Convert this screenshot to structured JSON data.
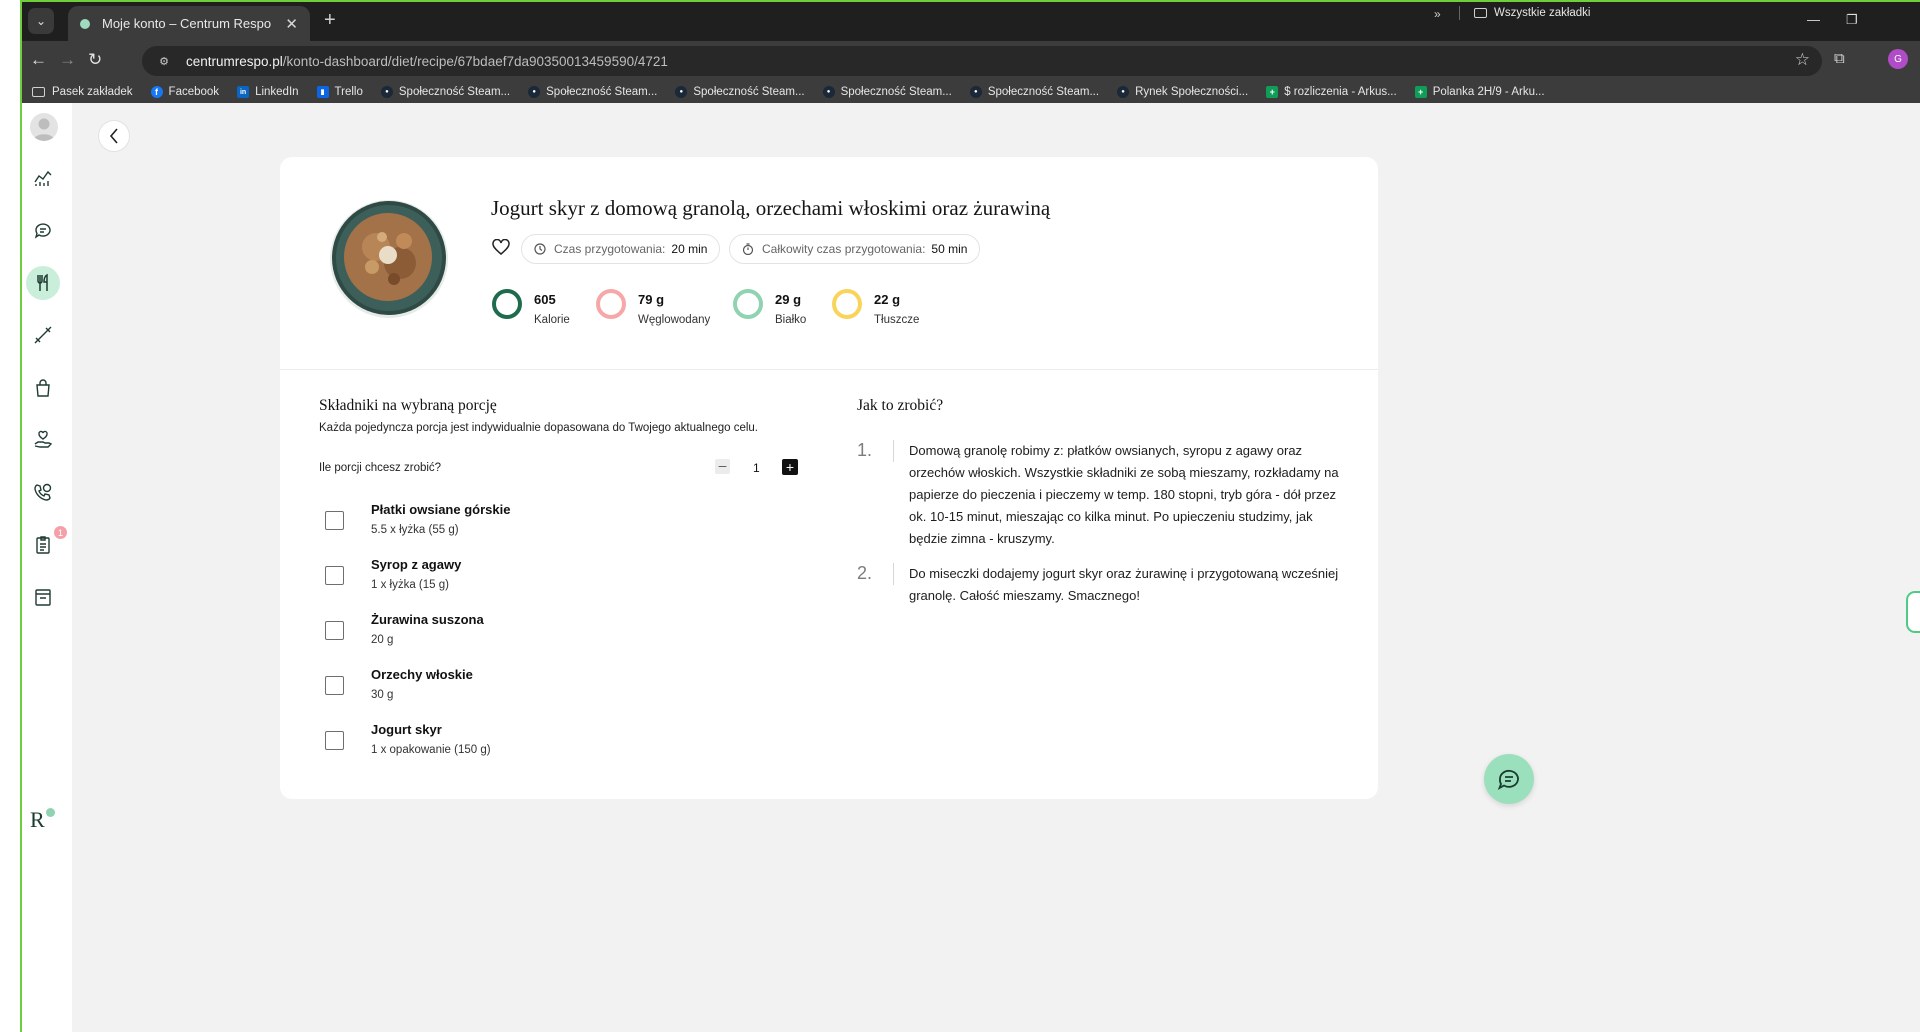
{
  "browser": {
    "tab_title": "Moje konto – Centrum Respo",
    "url_host": "centrumrespo.pl",
    "url_path": "/konto-dashboard/diet/recipe/67bdaef7da90350013459590/4721",
    "profile_initial": "G",
    "bookmarks": [
      {
        "label": "Pasek zakładek",
        "icon": "folder-icon"
      },
      {
        "label": "Facebook",
        "icon": "facebook-icon",
        "color": "#1877f2"
      },
      {
        "label": "LinkedIn",
        "icon": "linkedin-icon",
        "color": "#0a66c2"
      },
      {
        "label": "Trello",
        "icon": "trello-icon",
        "color": "#0c66e4"
      },
      {
        "label": "Społeczność Steam...",
        "icon": "steam-icon"
      },
      {
        "label": "Społeczność Steam...",
        "icon": "steam-icon"
      },
      {
        "label": "Społeczność Steam...",
        "icon": "steam-icon"
      },
      {
        "label": "Społeczność Steam...",
        "icon": "steam-icon"
      },
      {
        "label": "Społeczność Steam...",
        "icon": "steam-icon"
      },
      {
        "label": "Rynek Społeczności...",
        "icon": "steam-icon"
      },
      {
        "label": "$ rozliczenia - Arkus...",
        "icon": "sheets-icon",
        "color": "#0f9d58"
      },
      {
        "label": "Polanka 2H/9 - Arku...",
        "icon": "sheets-icon",
        "color": "#0f9d58"
      }
    ],
    "all_bookmarks_label": "Wszystkie zakładki"
  },
  "sidebar": {
    "notification_count": "1",
    "logo_text": "R"
  },
  "recipe": {
    "title": "Jogurt skyr z domową granolą, orzechami włoskimi oraz żurawiną",
    "prep_time_label": "Czas przygotowania:",
    "prep_time_value": "20 min",
    "total_time_label": "Całkowity czas przygotowania:",
    "total_time_value": "50 min",
    "macros": [
      {
        "value": "605",
        "label": "Kalorie",
        "color": "#1e6b4d"
      },
      {
        "value": "79 g",
        "label": "Węglowodany",
        "color": "#f7a7a7"
      },
      {
        "value": "29 g",
        "label": "Białko",
        "color": "#8fd3b0"
      },
      {
        "value": "22 g",
        "label": "Tłuszcze",
        "color": "#f9d45c"
      }
    ]
  },
  "ingredients": {
    "heading": "Składniki na wybraną porcję",
    "subtitle": "Każda pojedyncza porcja jest indywidualnie dopasowana do Twojego aktualnego celu.",
    "portion_question": "Ile porcji chcesz zrobić?",
    "portion_count": "1",
    "items": [
      {
        "name": "Płatki owsiane górskie",
        "qty": "5.5 x łyżka (55 g)"
      },
      {
        "name": "Syrop z agawy",
        "qty": "1 x łyżka (15 g)"
      },
      {
        "name": "Żurawina suszona",
        "qty": "20 g"
      },
      {
        "name": "Orzechy włoskie",
        "qty": "30 g"
      },
      {
        "name": "Jogurt skyr",
        "qty": "1 x opakowanie (150 g)"
      }
    ]
  },
  "steps": {
    "heading": "Jak to zrobić?",
    "items": [
      {
        "num": "1.",
        "text": "Domową granolę robimy z: płatków owsianych, syropu z agawy oraz orzechów włoskich. Wszystkie składniki ze sobą mieszamy, rozkładamy na papierze do pieczenia i pieczemy w temp. 180 stopni, tryb góra - dół przez ok. 10-15 minut, mieszając co kilka minut. Po upieczeniu studzimy, jak będzie zimna - kruszymy."
      },
      {
        "num": "2.",
        "text": "Do miseczki dodajemy jogurt skyr oraz żurawinę i przygotowaną wcześniej granolę. Całość mieszamy. Smacznego!"
      }
    ]
  },
  "colors": {
    "accent_green": "#8fd3b0",
    "active_nav_bg": "#c9eeda",
    "brand_dark": "#1a3c2e"
  }
}
